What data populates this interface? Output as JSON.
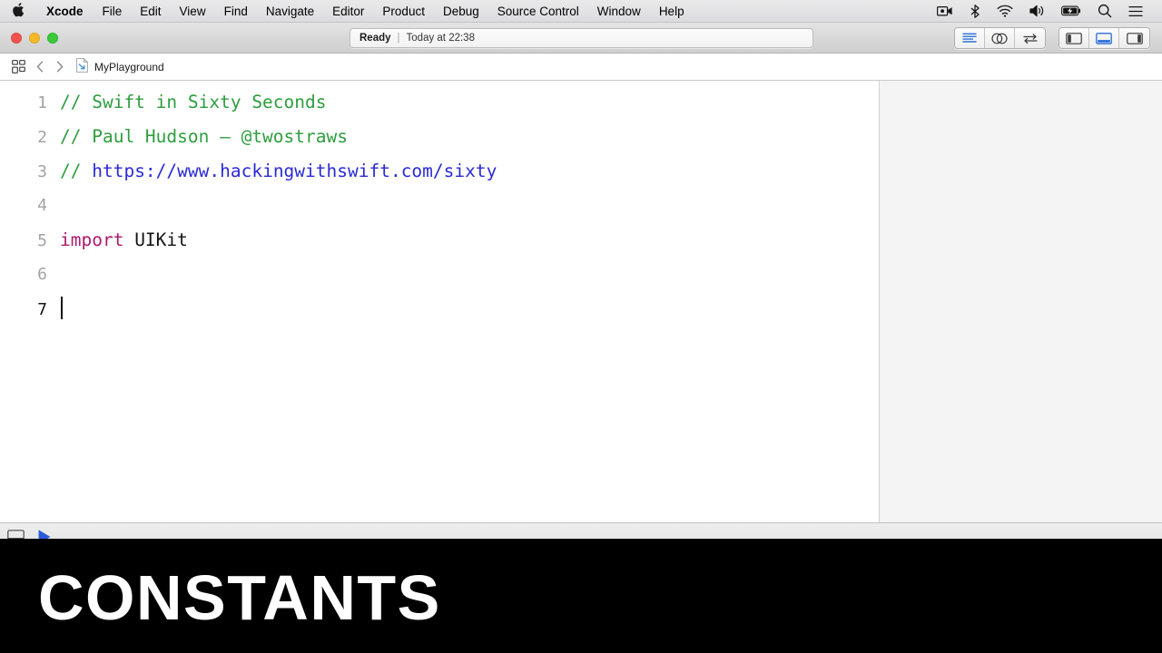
{
  "menubar": {
    "apple_icon": "apple-logo-icon",
    "items": [
      {
        "label": "Xcode",
        "bold": true
      },
      {
        "label": "File",
        "bold": false
      },
      {
        "label": "Edit",
        "bold": false
      },
      {
        "label": "View",
        "bold": false
      },
      {
        "label": "Find",
        "bold": false
      },
      {
        "label": "Navigate",
        "bold": false
      },
      {
        "label": "Editor",
        "bold": false
      },
      {
        "label": "Product",
        "bold": false
      },
      {
        "label": "Debug",
        "bold": false
      },
      {
        "label": "Source Control",
        "bold": false
      },
      {
        "label": "Window",
        "bold": false
      },
      {
        "label": "Help",
        "bold": false
      }
    ],
    "status_icons": [
      "screen-recording-icon",
      "bluetooth-icon",
      "wifi-icon",
      "volume-icon",
      "battery-charging-icon",
      "spotlight-search-icon",
      "control-center-icon"
    ]
  },
  "window": {
    "traffic_lights": [
      "close-button",
      "minimize-button",
      "zoom-button"
    ],
    "activity": {
      "status": "Ready",
      "separator": "|",
      "timestamp": "Today at 22:38"
    },
    "editor_mode_buttons": [
      "standard-editor-icon",
      "assistant-editor-icon",
      "version-editor-icon"
    ],
    "panel_buttons": [
      "navigator-toggle-icon",
      "debug-area-toggle-icon",
      "inspector-toggle-icon"
    ],
    "active_panel_button": "debug-area-toggle-icon"
  },
  "jumpbar": {
    "grid_icon": "related-items-icon",
    "back_icon": "chevron-left-icon",
    "forward_icon": "chevron-right-icon",
    "file_icon": "playground-file-icon",
    "file_name": "MyPlayground"
  },
  "editor": {
    "lines": [
      {
        "number": "1",
        "active": false,
        "tokens": [
          {
            "text": "// Swift in Sixty Seconds",
            "type": "comment"
          }
        ]
      },
      {
        "number": "2",
        "active": false,
        "tokens": [
          {
            "text": "// Paul Hudson — @twostraws",
            "type": "comment"
          }
        ]
      },
      {
        "number": "3",
        "active": false,
        "tokens": [
          {
            "text": "// ",
            "type": "comment"
          },
          {
            "text": "https://www.hackingwithswift.com/sixty",
            "type": "url"
          }
        ]
      },
      {
        "number": "4",
        "active": false,
        "tokens": []
      },
      {
        "number": "5",
        "active": false,
        "tokens": [
          {
            "text": "import",
            "type": "keyword"
          },
          {
            "text": " UIKit",
            "type": "plain"
          }
        ]
      },
      {
        "number": "6",
        "active": false,
        "tokens": []
      },
      {
        "number": "7",
        "active": true,
        "tokens": [],
        "caret": true
      }
    ]
  },
  "debugbar": {
    "icons": [
      "console-toggle-icon",
      "run-playground-icon"
    ]
  },
  "overlay": {
    "title": "CONSTANTS"
  },
  "colors": {
    "comment": "#2e9e3e",
    "url": "#2a2ad6",
    "keyword": "#ad1a6c",
    "plain_code": "#141414",
    "line_number": "#a3a3a3",
    "line_number_active": "#141414",
    "accent_blue": "#2a6ed6",
    "overlay_bg": "#000000",
    "overlay_text": "#ffffff",
    "results_pane_bg": "#f4f4f4"
  }
}
